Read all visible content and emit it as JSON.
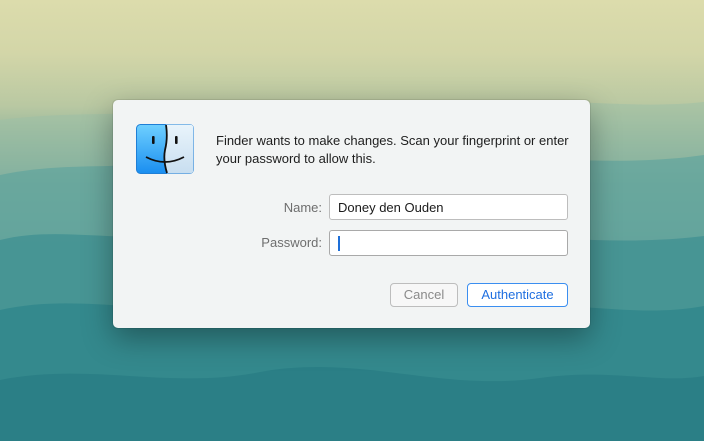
{
  "dialog": {
    "message": "Finder wants to make changes. Scan your fingerprint or enter your password to allow this.",
    "app_icon": "finder-icon",
    "name_label": "Name:",
    "name_value": "Doney den Ouden",
    "password_label": "Password:",
    "password_value": "",
    "cancel_label": "Cancel",
    "authenticate_label": "Authenticate"
  },
  "colors": {
    "accent": "#1f6fe0",
    "dialog_background": "#f2f4f4"
  }
}
